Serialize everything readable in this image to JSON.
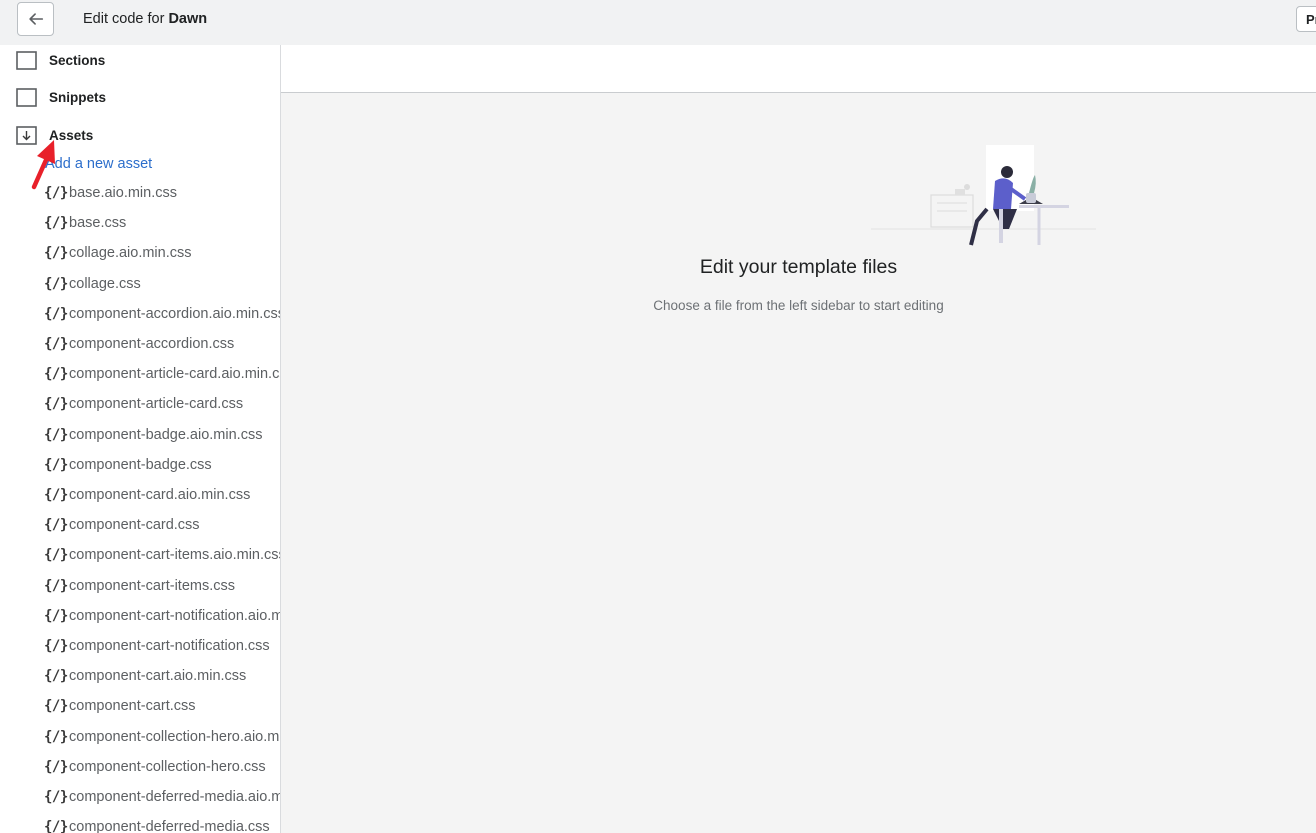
{
  "header": {
    "title_prefix": "Edit code for",
    "theme_name": "Dawn",
    "preview_label": "Preview"
  },
  "sidebar": {
    "folders": [
      {
        "label": "Sections",
        "state": "collapsed"
      },
      {
        "label": "Snippets",
        "state": "collapsed"
      },
      {
        "label": "Assets",
        "state": "expanded"
      }
    ],
    "add_asset_label": "Add a new asset",
    "file_icon_glyph": "{/}",
    "files": [
      "base.aio.min.css",
      "base.css",
      "collage.aio.min.css",
      "collage.css",
      "component-accordion.aio.min.css",
      "component-accordion.css",
      "component-article-card.aio.min.css",
      "component-article-card.css",
      "component-badge.aio.min.css",
      "component-badge.css",
      "component-card.aio.min.css",
      "component-card.css",
      "component-cart-items.aio.min.css",
      "component-cart-items.css",
      "component-cart-notification.aio.min.css",
      "component-cart-notification.css",
      "component-cart.aio.min.css",
      "component-cart.css",
      "component-collection-hero.aio.min.css",
      "component-collection-hero.css",
      "component-deferred-media.aio.min.css",
      "component-deferred-media.css"
    ]
  },
  "main": {
    "empty_title": "Edit your template files",
    "empty_subtitle": "Choose a file from the left sidebar to start editing"
  },
  "colors": {
    "link": "#2c6ecb",
    "annotation_arrow": "#e8202a",
    "illustration_accent": "#5c5fcb"
  }
}
